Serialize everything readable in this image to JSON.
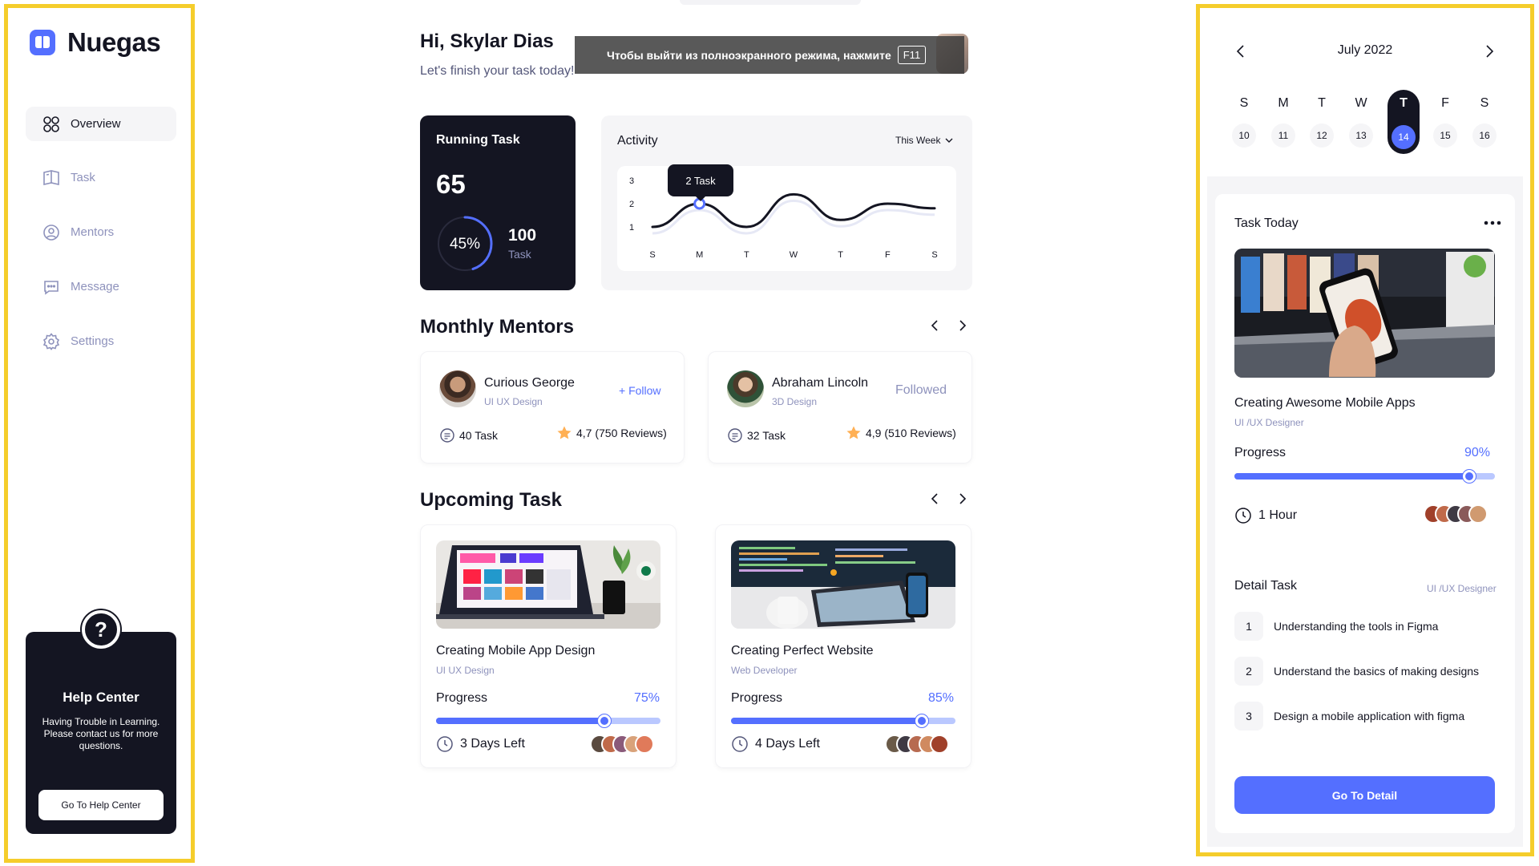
{
  "app": {
    "name": "Nuegas"
  },
  "sidebar": {
    "items": [
      {
        "label": "Overview",
        "active": true
      },
      {
        "label": "Task",
        "active": false
      },
      {
        "label": "Mentors",
        "active": false
      },
      {
        "label": "Message",
        "active": false
      },
      {
        "label": "Settings",
        "active": false
      }
    ],
    "help": {
      "badge": "?",
      "title": "Help Center",
      "description": "Having Trouble in Learning. Please contact us for more questions.",
      "button": "Go To Help Center"
    }
  },
  "header": {
    "greeting": "Hi, Skylar Dias",
    "subtitle": "Let's finish your task today!"
  },
  "fullscreen_notice": {
    "text": "Чтобы выйти из полноэкранного режима, нажмите",
    "key": "F11"
  },
  "running_task": {
    "title": "Running Task",
    "count": "65",
    "percent_label": "45%",
    "percent": 45,
    "total": "100",
    "total_label": "Task"
  },
  "activity": {
    "title": "Activity",
    "filter": "This Week",
    "tooltip": "2 Task"
  },
  "chart_data": {
    "type": "line",
    "title": "Activity",
    "categories": [
      "S",
      "M",
      "T",
      "W",
      "T",
      "F",
      "S"
    ],
    "values": [
      1.0,
      2.0,
      1.0,
      2.4,
      1.3,
      2.0,
      1.8
    ],
    "y_ticks": [
      "1",
      "2",
      "3"
    ],
    "ylim": [
      1,
      3
    ],
    "highlight_index": 1,
    "line_color": "#141522",
    "highlight_color": "#546FFF"
  },
  "mentors": {
    "title": "Monthly Mentors",
    "items": [
      {
        "name": "Curious George",
        "role": "UI UX Design",
        "action": "+ Follow",
        "followed": false,
        "tasks": "40 Task",
        "rating": "4,7 (750 Reviews)"
      },
      {
        "name": "Abraham Lincoln",
        "role": "3D Design",
        "action": "Followed",
        "followed": true,
        "tasks": "32 Task",
        "rating": "4,9 (510 Reviews)"
      }
    ]
  },
  "upcoming": {
    "title": "Upcoming Task",
    "items": [
      {
        "title": "Creating Mobile App Design",
        "role": "UI UX Design",
        "progress_label": "Progress",
        "percent_label": "75%",
        "percent": 75,
        "time": "3 Days Left"
      },
      {
        "title": "Creating Perfect Website",
        "role": "Web Developer",
        "progress_label": "Progress",
        "percent_label": "85%",
        "percent": 85,
        "time": "4 Days Left"
      }
    ]
  },
  "calendar": {
    "month": "July 2022",
    "weekdays": [
      "S",
      "M",
      "T",
      "W",
      "T",
      "F",
      "S"
    ],
    "days": [
      "10",
      "11",
      "12",
      "13",
      "14",
      "15",
      "16"
    ],
    "selected_index": 4
  },
  "task_today": {
    "title": "Task Today",
    "name": "Creating Awesome Mobile Apps",
    "role": "UI /UX Designer",
    "progress_label": "Progress",
    "percent_label": "90%",
    "percent": 90,
    "time": "1 Hour"
  },
  "detail_task": {
    "title": "Detail Task",
    "role": "UI /UX Designer",
    "steps": [
      {
        "num": "1",
        "text": "Understanding the tools in Figma"
      },
      {
        "num": "2",
        "text": "Understand the basics of making designs"
      },
      {
        "num": "3",
        "text": "Design a mobile application with figma"
      }
    ],
    "button": "Go To Detail"
  },
  "colors": {
    "primary": "#546FFF",
    "dark": "#141522",
    "muted": "#8E92BC",
    "highlight_frame": "#F5CD2B"
  }
}
